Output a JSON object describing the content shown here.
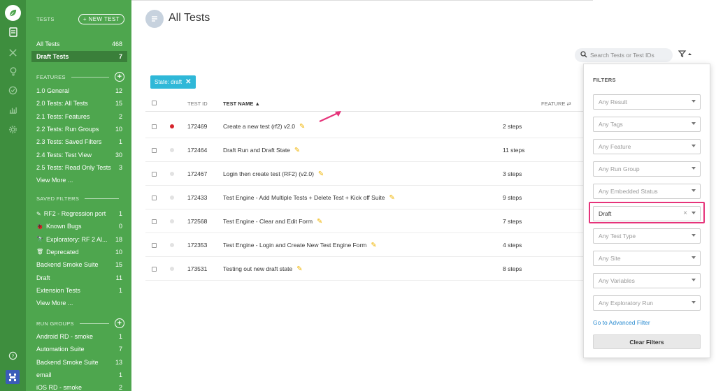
{
  "page": {
    "title": "All Tests"
  },
  "sidebar": {
    "tests_header": "TESTS",
    "new_test_label": "+ New Test",
    "tests": [
      {
        "label": "All Tests",
        "count": "468"
      },
      {
        "label": "Draft Tests",
        "count": "7"
      }
    ],
    "features_header": "FEATURES",
    "features": [
      {
        "label": "1.0 General",
        "count": "12"
      },
      {
        "label": "2.0 Tests: All Tests",
        "count": "15"
      },
      {
        "label": "2.1 Tests: Features",
        "count": "2"
      },
      {
        "label": "2.2 Tests: Run Groups",
        "count": "10"
      },
      {
        "label": "2.3 Tests: Saved Filters",
        "count": "1"
      },
      {
        "label": "2.4 Tests: Test View",
        "count": "30"
      },
      {
        "label": "2.5 Tests: Read Only Tests",
        "count": "3"
      }
    ],
    "features_more": "View More ...",
    "saved_filters_header": "SAVED FILTERS",
    "saved_filters": [
      {
        "icon": "✎",
        "label": "RF2 - Regression port",
        "count": "1"
      },
      {
        "icon": "🐞",
        "label": "Known Bugs",
        "count": "0"
      },
      {
        "icon": "🔭",
        "label": "Exploratory: RF 2 Al...",
        "count": "18"
      },
      {
        "icon": "🗑",
        "label": "Deprecated",
        "count": "10"
      },
      {
        "icon": "",
        "label": "Backend Smoke Suite",
        "count": "15"
      },
      {
        "icon": "",
        "label": "Draft",
        "count": "11"
      },
      {
        "icon": "",
        "label": "Extension Tests",
        "count": "1"
      }
    ],
    "saved_more": "View More ...",
    "run_groups_header": "RUN GROUPS",
    "run_groups": [
      {
        "label": "Android RD - smoke",
        "count": "1"
      },
      {
        "label": "Automation Suite",
        "count": "7"
      },
      {
        "label": "Backend Smoke Suite",
        "count": "13"
      },
      {
        "label": "email",
        "count": "1"
      },
      {
        "label": "iOS RD - smoke",
        "count": "2"
      }
    ]
  },
  "search": {
    "placeholder": "Search Tests or Test IDs"
  },
  "active_chip": "State: draft",
  "table": {
    "headers": {
      "test_id": "TEST ID",
      "test_name": "TEST NAME",
      "feature": "FEATURE"
    },
    "rows": [
      {
        "id": "172469",
        "name": "Create a new test (rf2) v2.0",
        "steps": "2 steps",
        "status": "red"
      },
      {
        "id": "172464",
        "name": "Draft Run and Draft State",
        "steps": "11 steps",
        "status": "grey"
      },
      {
        "id": "172467",
        "name": "Login then create test (RF2) (v2.0)",
        "steps": "3 steps",
        "status": "grey"
      },
      {
        "id": "172433",
        "name": "Test Engine - Add Multiple Tests + Delete Test + Kick off Suite",
        "steps": "9 steps",
        "status": "grey"
      },
      {
        "id": "172568",
        "name": "Test Engine - Clear and Edit Form",
        "steps": "7 steps",
        "status": "grey"
      },
      {
        "id": "172353",
        "name": "Test Engine - Login and Create New Test Engine Form",
        "steps": "4 steps",
        "status": "grey"
      },
      {
        "id": "173531",
        "name": "Testing out new draft state",
        "steps": "8 steps",
        "status": "grey"
      }
    ]
  },
  "filters": {
    "header": "FILTERS",
    "dropdowns": [
      {
        "name": "result",
        "value": "Any Result",
        "active": false
      },
      {
        "name": "tags",
        "value": "Any Tags",
        "active": false
      },
      {
        "name": "feature",
        "value": "Any Feature",
        "active": false
      },
      {
        "name": "run-group",
        "value": "Any Run Group",
        "active": false
      },
      {
        "name": "embedded-status",
        "value": "Any Embedded Status",
        "active": false
      },
      {
        "name": "state",
        "value": "Draft",
        "active": true
      },
      {
        "name": "test-type",
        "value": "Any Test Type",
        "active": false
      },
      {
        "name": "site",
        "value": "Any Site",
        "active": false
      },
      {
        "name": "variables",
        "value": "Any Variables",
        "active": false
      },
      {
        "name": "exploratory-run",
        "value": "Any Exploratory Run",
        "active": false
      }
    ],
    "advanced_link": "Go to Advanced Filter",
    "clear_button": "Clear Filters"
  },
  "colors": {
    "rail": "#3e8e3e",
    "sidebar": "#4ea64e",
    "chip": "#2fb8d8",
    "highlight": "#e6337a",
    "link": "#2a8bd0"
  }
}
